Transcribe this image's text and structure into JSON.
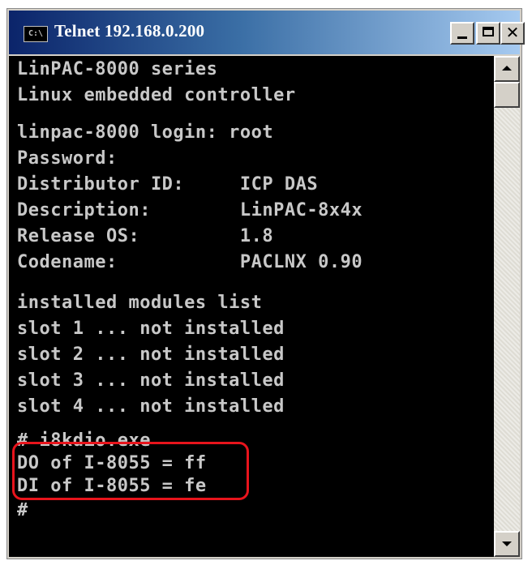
{
  "window": {
    "title": "Telnet 192.168.0.200",
    "icon_label": "C:\\",
    "controls": {
      "minimize": "minimize-icon",
      "maximize": "maximize-icon",
      "close": "✕"
    }
  },
  "terminal": {
    "lines": [
      "LinPAC-8000 series",
      "Linux embedded controller",
      "linpac-8000 login: root",
      "Password:",
      "Distributor ID:     ICP DAS",
      "Description:        LinPAC-8x4x",
      "Release OS:         1.8",
      "Codename:           PACLNX 0.90",
      "installed modules list",
      "slot 1 ... not installed",
      "slot 2 ... not installed",
      "slot 3 ... not installed",
      "slot 4 ... not installed",
      "# i8kdio.exe",
      "DO of I-8055 = ff",
      "DI of I-8055 = fe",
      "#"
    ]
  },
  "colors": {
    "title_bar_start": "#0b246a",
    "terminal_bg": "#000000",
    "terminal_text": "#c8c8c8",
    "highlight": "#e8141c"
  }
}
